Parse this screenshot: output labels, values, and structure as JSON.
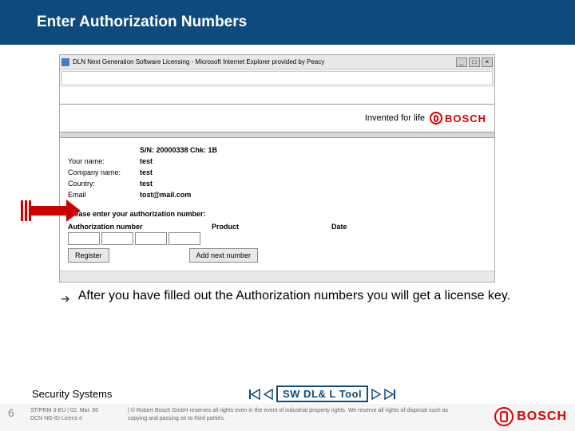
{
  "header": {
    "title": "Enter Authorization Numbers"
  },
  "browser": {
    "title": "DLN Next Generation Software Licensing - Microsoft Internet Explorer provided by Peacy"
  },
  "brand": {
    "slogan": "Invented for life",
    "name": "BOSCH"
  },
  "info": {
    "sn_label": "S/N: 20000338 Chk: 1B",
    "rows": [
      {
        "label": "Your name:",
        "value": "test"
      },
      {
        "label": "Company name:",
        "value": "test"
      },
      {
        "label": "Country:",
        "value": "test"
      },
      {
        "label": "Email",
        "value": "tost@mail.com"
      }
    ]
  },
  "instruction": "Please enter your authorization number:",
  "table": {
    "col_auth": "Authorization number",
    "col_prod": "Product",
    "col_date": "Date"
  },
  "buttons": {
    "register": "Register",
    "add": "Add next number"
  },
  "bullet": "After you have filled out the Authorization numbers you will get a license key.",
  "footer": {
    "left": "Security Systems",
    "center": "SW DL& L Tool",
    "page": "6",
    "copy_l": "ST/PRM 3-EU | 02. Mar. 06\nDCN NG-ID Licens e",
    "copy_r": "| © Robert Bosch GmbH reserves all rights even in the event of industrial property rights. We reserve all rights of disposal such as copying and passing on to third parties.",
    "brand": "BOSCH"
  }
}
